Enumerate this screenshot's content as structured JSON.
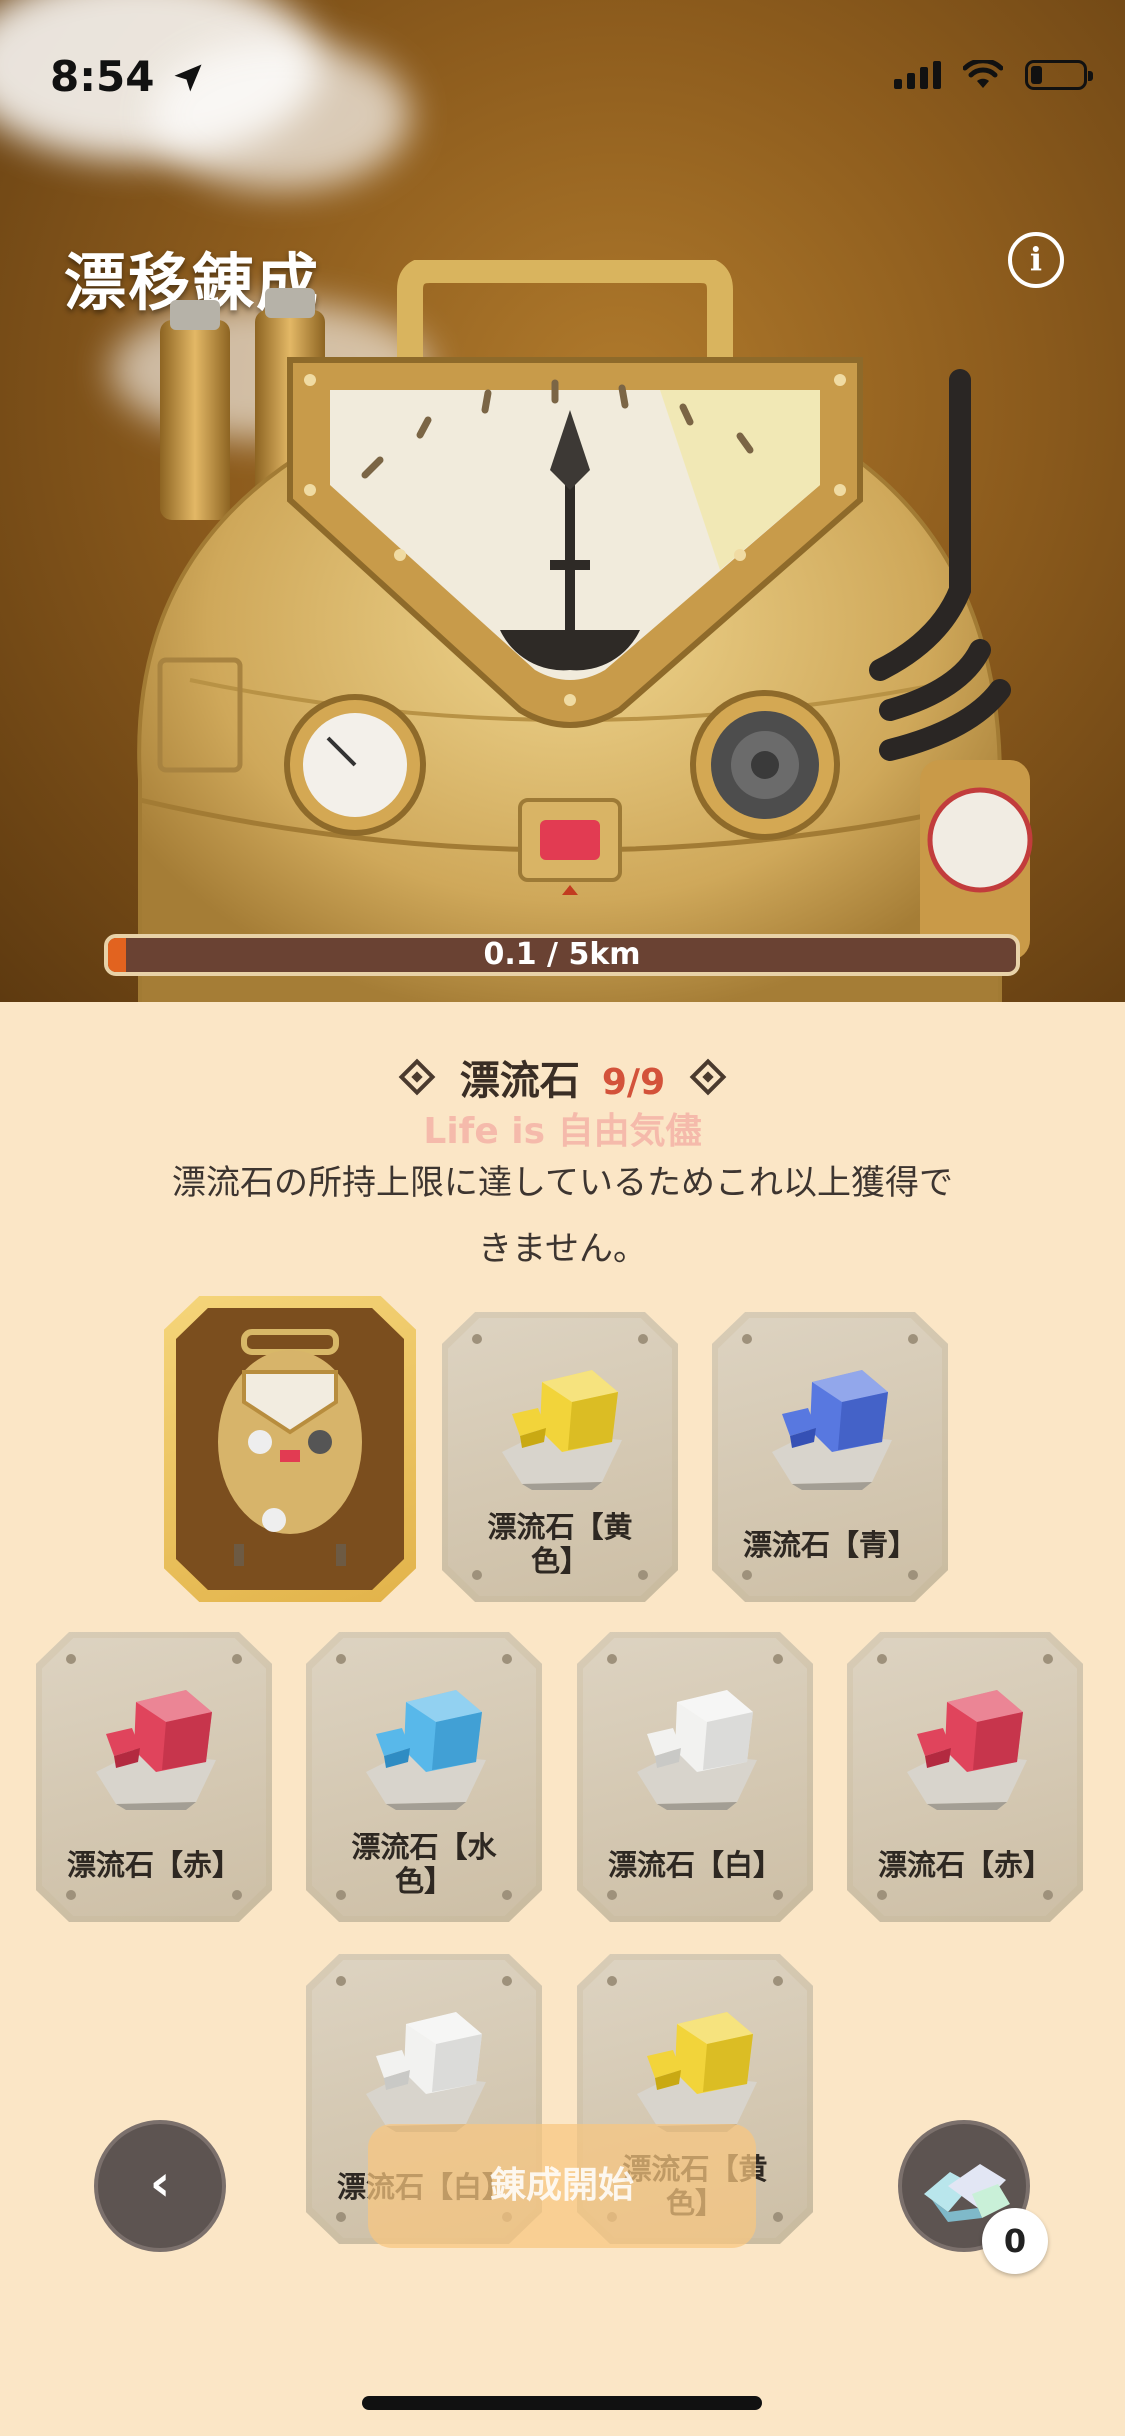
{
  "status_bar": {
    "time": "8:54",
    "icons": [
      "location-arrow-icon",
      "cellular-signal-icon",
      "wifi-icon",
      "battery-icon"
    ]
  },
  "header": {
    "title": "漂移錬成",
    "info_icon": "info-icon",
    "info_glyph": "i"
  },
  "progress": {
    "text": "0.1 / 5km",
    "current_km": 0.1,
    "total_km": 5,
    "fill_color": "#e2631f"
  },
  "stone_status": {
    "name": "漂流石",
    "count": "9/9",
    "watermark": "Life is 自由気儘",
    "message": "漂流石の所持上限に達しているためこれ以上獲得できません。",
    "message_line1": "漂流石の所持上限に達しているためこれ以上獲得で",
    "message_line2": "きません。"
  },
  "cards": [
    {
      "label": "",
      "type": "machine",
      "selected": true
    },
    {
      "label": "漂流石【黄色】",
      "label_line1": "漂流石【黄",
      "label_line2": "色】",
      "color": "#f2d43a",
      "color_dark": "#c9a913"
    },
    {
      "label": "漂流石【青】",
      "color": "#5878e0",
      "color_dark": "#3550b5"
    },
    {
      "label": "漂流石【赤】",
      "color": "#e0445c",
      "color_dark": "#b32a40"
    },
    {
      "label": "漂流石【水色】",
      "label_line1": "漂流石【水",
      "label_line2": "色】",
      "color": "#58b8ea",
      "color_dark": "#2f8cc3"
    },
    {
      "label": "漂流石【白】",
      "color": "#f2f2f0",
      "color_dark": "#c9c9c6"
    },
    {
      "label": "漂流石【赤】",
      "color": "#e0445c",
      "color_dark": "#b32a40"
    },
    {
      "label": "漂流石【白】",
      "color": "#f2f2f0",
      "color_dark": "#c9c9c6"
    },
    {
      "label": "漂流石【黄色】",
      "label_line1": "漂流石【黄",
      "label_line2": "色】",
      "color": "#f2d43a",
      "color_dark": "#c9a913"
    }
  ],
  "bottom_bar": {
    "back_glyph": "‹",
    "start_label": "錬成開始",
    "crystal_count": "0"
  }
}
